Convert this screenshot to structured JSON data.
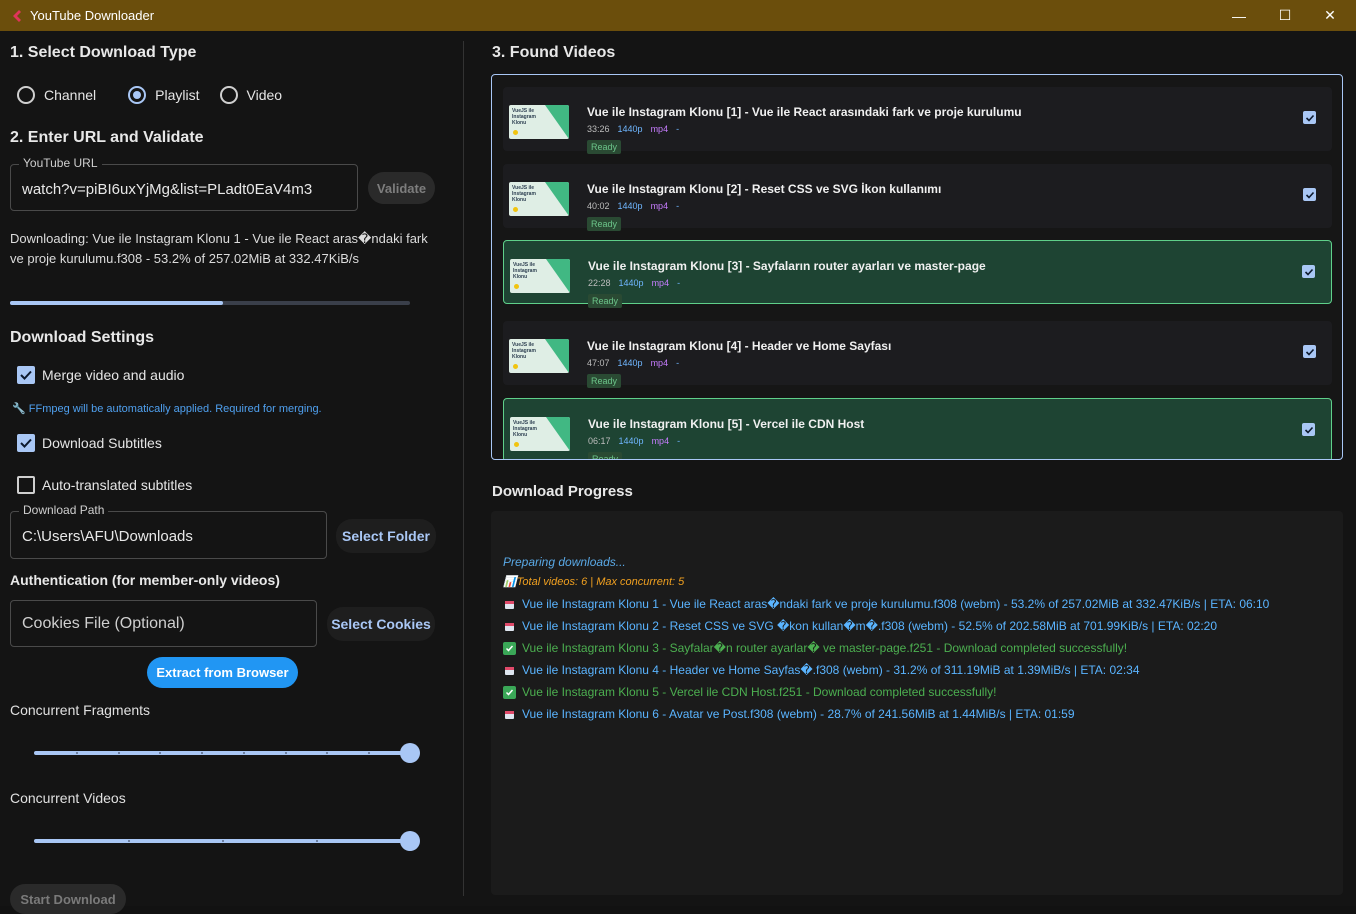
{
  "window": {
    "title": "YouTube Downloader",
    "minimize": "—",
    "maximize": "☐",
    "close": "✕"
  },
  "left": {
    "section1_title": "1. Select Download Type",
    "types": [
      {
        "label": "Channel",
        "selected": false
      },
      {
        "label": "Playlist",
        "selected": true
      },
      {
        "label": "Video",
        "selected": false
      }
    ],
    "section2_title": "2. Enter URL and Validate",
    "url": {
      "legend": "YouTube URL",
      "value": "watch?v=piBI6uxYjMg&list=PLadt0EaV4m3"
    },
    "validate_label": "Validate",
    "status": "Downloading: Vue ile Instagram Klonu 1 - Vue ile React aras�ndaki fark ve proje kurulumu.f308 - 53.2% of 257.02MiB at 332.47KiB/s",
    "progress": 0.532,
    "settings_title": "Download Settings",
    "merge_label": "Merge video and audio",
    "merge_checked": true,
    "ffmpeg_note": "🔧 FFmpeg will be automatically applied. Required for merging.",
    "subs_label": "Download Subtitles",
    "subs_checked": true,
    "autosubs_label": "Auto-translated subtitles",
    "autosubs_checked": false,
    "path": {
      "legend": "Download Path",
      "value": "C:\\Users\\AFU\\Downloads"
    },
    "select_folder_label": "Select Folder",
    "auth_title": "Authentication (for member-only videos)",
    "cookies_placeholder": "Cookies File (Optional)",
    "select_cookies_label": "Select Cookies",
    "extract_label": "Extract from Browser",
    "fragments_label": "Concurrent Fragments",
    "fragments_value": 1.0,
    "videos_label": "Concurrent Videos",
    "videos_value": 1.0,
    "start_label": "Start Download"
  },
  "right": {
    "found_title": "3. Found Videos",
    "videos": [
      {
        "title": "Vue ile Instagram Klonu [1] - Vue ile React arasındaki fark ve proje kurulumu",
        "duration": "33:26",
        "res": "1440p",
        "fmt": "mp4",
        "dash": "-",
        "status": "Ready",
        "done": false
      },
      {
        "title": "Vue ile Instagram Klonu [2] - Reset CSS ve SVG İkon kullanımı",
        "duration": "40:02",
        "res": "1440p",
        "fmt": "mp4",
        "dash": "-",
        "status": "Ready",
        "done": false
      },
      {
        "title": "Vue ile Instagram Klonu [3] - Sayfaların router ayarları ve master-page",
        "duration": "22:28",
        "res": "1440p",
        "fmt": "mp4",
        "dash": "-",
        "status": "Ready",
        "done": true
      },
      {
        "title": "Vue ile Instagram Klonu [4] - Header ve Home Sayfası",
        "duration": "47:07",
        "res": "1440p",
        "fmt": "mp4",
        "dash": "-",
        "status": "Ready",
        "done": false
      },
      {
        "title": "Vue ile Instagram Klonu [5] - Vercel ile CDN Host",
        "duration": "06:17",
        "res": "1440p",
        "fmt": "mp4",
        "dash": "-",
        "status": "Ready",
        "done": true
      }
    ],
    "thumb_text": "VueJS ile Instagram Klonu",
    "progress_title": "Download Progress",
    "log": [
      {
        "kind": "info",
        "text": "Preparing downloads..."
      },
      {
        "kind": "meta",
        "text": "📊Total videos: 6 | Max concurrent: 5"
      },
      {
        "kind": "progress",
        "text": "Vue ile Instagram Klonu 1 - Vue ile React aras�ndaki fark ve proje kurulumu.f308 (webm) - 53.2% of 257.02MiB at 332.47KiB/s | ETA: 06:10"
      },
      {
        "kind": "progress",
        "text": "Vue ile Instagram Klonu 2 - Reset CSS ve SVG �kon kullan�m�.f308 (webm) - 52.5% of 202.58MiB at 701.99KiB/s | ETA: 02:20"
      },
      {
        "kind": "done",
        "text": "Vue ile Instagram Klonu 3 - Sayfalar�n router ayarlar� ve master-page.f251 - Download completed successfully!"
      },
      {
        "kind": "progress",
        "text": "Vue ile Instagram Klonu 4 - Header ve Home Sayfas�.f308 (webm) - 31.2% of 311.19MiB at 1.39MiB/s | ETA: 02:34"
      },
      {
        "kind": "done",
        "text": "Vue ile Instagram Klonu 5 - Vercel ile CDN Host.f251 - Download completed successfully!"
      },
      {
        "kind": "progress",
        "text": "Vue ile Instagram Klonu 6 - Avatar ve Post.f308 (webm) - 28.7% of 241.56MiB at 1.44MiB/s | ETA: 01:59"
      }
    ],
    "colors": {
      "info": "#5aa9e6",
      "meta": "#f0a020",
      "progress": "#5ab4ff",
      "done": "#4caf50"
    }
  }
}
